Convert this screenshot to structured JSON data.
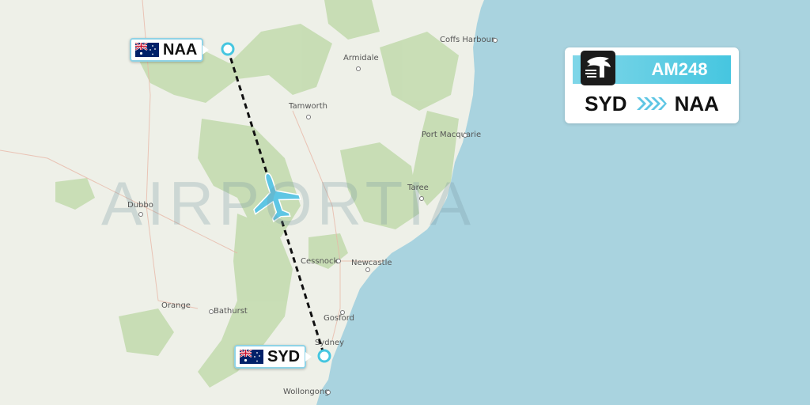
{
  "flight": {
    "number": "AM248",
    "origin": "SYD",
    "destination": "NAA",
    "airline_logo_icon": "aeromexico-eagle-icon",
    "header_color": "#46c6e0"
  },
  "airports": {
    "origin": {
      "code": "SYD",
      "flag_icon": "australia-flag-icon"
    },
    "destination": {
      "code": "NAA",
      "flag_icon": "australia-flag-icon"
    }
  },
  "watermark": "AIRPORTIA",
  "towns": [
    "Coffs Harbour",
    "Armidale",
    "Tamworth",
    "Port Macquarie",
    "Taree",
    "Dubbo",
    "Cessnock",
    "Newcastle",
    "Orange",
    "Bathurst",
    "Gosford",
    "Sydney",
    "Wollongong"
  ],
  "colors": {
    "ocean": "#a9d3df",
    "land": "#eef0e8",
    "forest": "#c4dcb0",
    "route_line": "#111111",
    "airport_marker": "#46c6e0"
  },
  "icons": {
    "plane": "airplane-icon"
  }
}
